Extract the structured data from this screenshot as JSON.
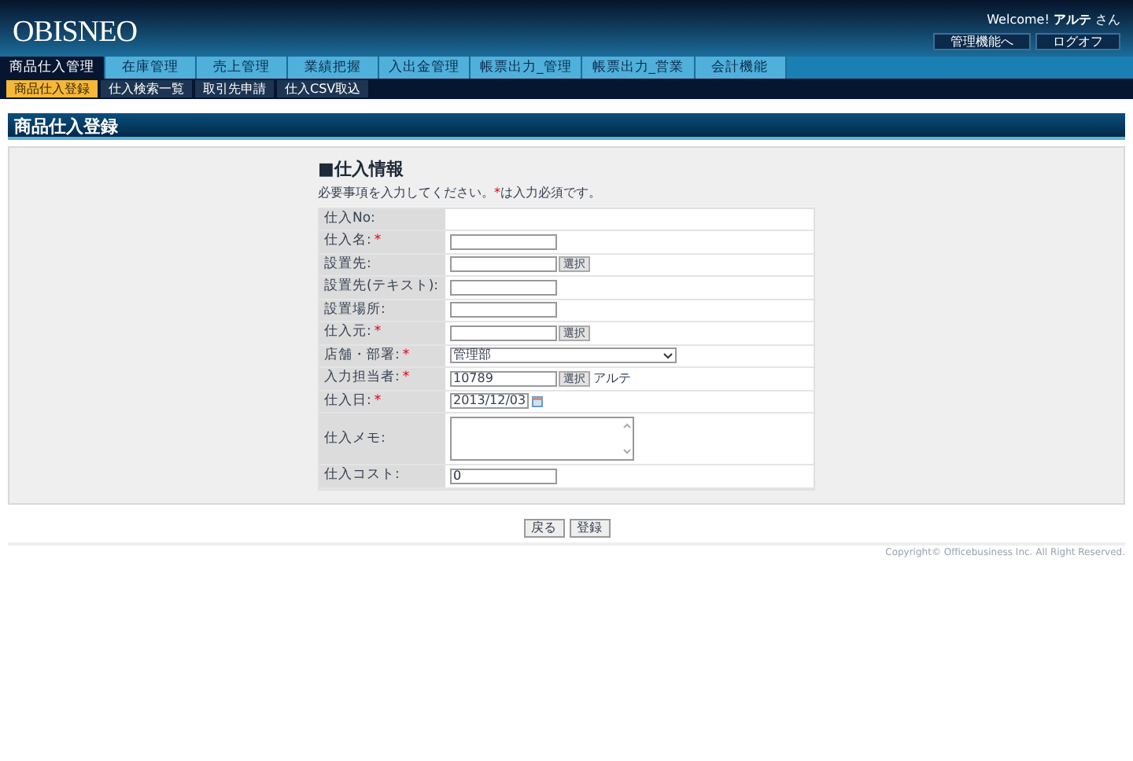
{
  "header": {
    "logo": "OBISNEO",
    "welcome": "Welcome! **アルテ** さん",
    "buttons": [
      "管理機能へ",
      "ログオフ"
    ]
  },
  "tabs": [
    {
      "label": "商品仕入管理",
      "selected": true
    },
    {
      "label": "在庫管理",
      "selected": false
    },
    {
      "label": "売上管理",
      "selected": false
    },
    {
      "label": "業績把握",
      "selected": false
    },
    {
      "label": "入出金管理",
      "selected": false
    },
    {
      "label": "帳票出力_管理",
      "selected": false
    },
    {
      "label": "帳票出力_営業",
      "selected": false
    },
    {
      "label": "会計機能",
      "selected": false
    }
  ],
  "sub_tabs": [
    {
      "label": "商品仕入登録",
      "selected": true
    },
    {
      "label": "仕入検索一覧",
      "selected": false
    },
    {
      "label": "取引先申請",
      "selected": false
    },
    {
      "label": "仕入CSV取込",
      "selected": false
    }
  ],
  "page_title": "商品仕入登録",
  "form": {
    "section_title": "■仕入情報",
    "note": {
      "before": "必要事項を入力してください。",
      "mark": "*",
      "after": "は入力必須です。"
    },
    "fields": [
      {
        "label": "仕入No:",
        "kind": "empty"
      },
      {
        "label": "仕入名:",
        "mark": "*",
        "kind": "text"
      },
      {
        "label": "設置先:",
        "kind": "lookup",
        "button": "選択"
      },
      {
        "label": "設置先(テキスト):",
        "kind": "text"
      },
      {
        "label": "設置場所:",
        "kind": "text"
      },
      {
        "label": "仕入元:",
        "mark": "*",
        "kind": "lookup",
        "button": "選択"
      },
      {
        "label": "店舗・部署:",
        "mark": "*",
        "kind": "select",
        "value": "管理部"
      },
      {
        "label": "入力担当者:",
        "mark": "*",
        "kind": "lookup",
        "value": "10789",
        "button": "選択",
        "extra": "アルテ"
      },
      {
        "label": "仕入日:",
        "mark": "*",
        "kind": "date",
        "value": "2013/12/03"
      },
      {
        "label": "仕入メモ:",
        "kind": "textarea"
      },
      {
        "label": "仕入コスト:",
        "kind": "readonly",
        "value": "0"
      }
    ]
  },
  "buttons": [
    "戻る",
    "登録"
  ],
  "copyright": "Copyright© Officebusiness Inc. All Right Reserved."
}
